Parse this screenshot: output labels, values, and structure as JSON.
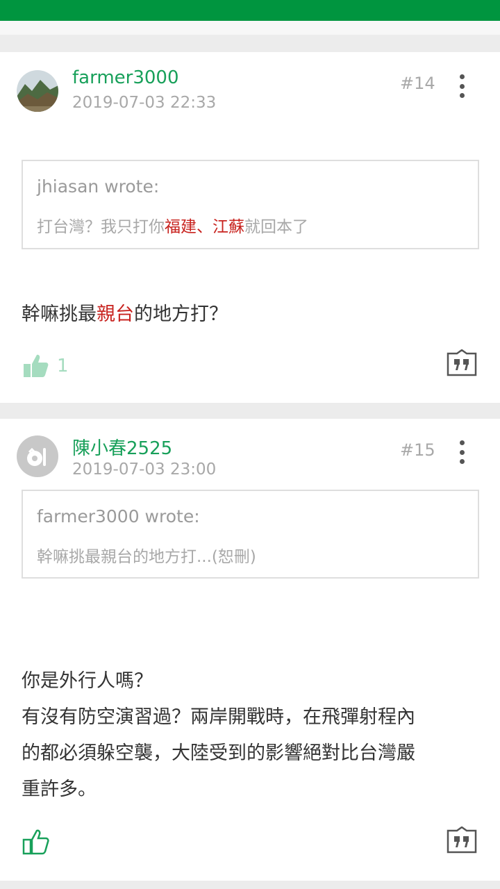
{
  "posts": [
    {
      "author": "farmer3000",
      "time": "2019-07-03 22:33",
      "floor": "#14",
      "quote": {
        "author_line": "jhiasan wrote:",
        "text_parts": [
          "打台灣？我只打你",
          "福建、江蘇",
          "就回本了"
        ]
      },
      "content_parts": [
        "幹嘛挑最",
        "親台",
        "的地方打？"
      ],
      "likes": "1",
      "icons": {
        "avatar": "mountain-avatar-photo",
        "like": "thumbs-up-icon",
        "reply": "reply-quote-icon",
        "more": "more-vertical-icon"
      }
    },
    {
      "author": "陳小春2525",
      "time": "2019-07-03 23:00",
      "floor": "#15",
      "quote": {
        "author_line": "farmer3000 wrote:",
        "text": "幹嘛挑最親台的地方打...(恕刪)"
      },
      "content_lines": [
        "你是外行人嗎？",
        "有沒有防空演習過？兩岸開戰時，在飛彈射程內",
        "的都必須躲空襲，大陸受到的影響絕對比台灣嚴",
        "重許多。"
      ],
      "icons": {
        "avatar": "default-avatar",
        "like": "thumbs-up-outline-icon",
        "reply": "reply-quote-icon",
        "more": "more-vertical-icon"
      }
    }
  ],
  "colors": {
    "brand_green": "#00953f",
    "author_green": "#18a05a",
    "highlight_red": "#c8231f"
  }
}
